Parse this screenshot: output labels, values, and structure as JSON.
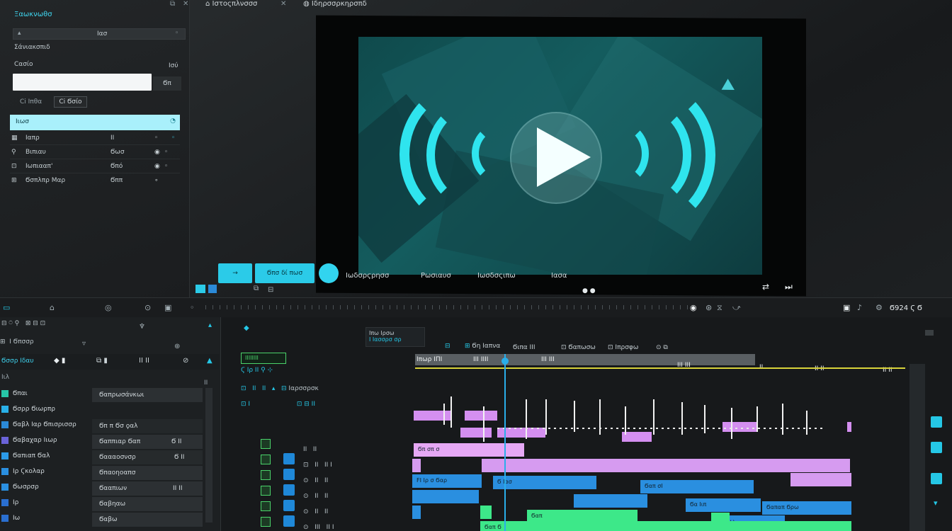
{
  "inspector": {
    "title": "Ξαωκνωθσ",
    "field_value": "Ιασ",
    "section": "Σάνιακσπιδ",
    "label_1": "Ϲασίο",
    "label_1_val": "Ισύ",
    "white_num": "Ϭπ",
    "tab_1": "Ci Ιπθα",
    "tab_2": "Ci Ϭσίο",
    "cyan_label": "Ιιωσ",
    "attrs": [
      {
        "name": "Ιαπρ",
        "val": "ΙΙ"
      },
      {
        "name": "Βιπιαυ",
        "val": "Ϭωσ"
      },
      {
        "name": "Ιωπιααπ'",
        "val": "Ϭπό"
      },
      {
        "name": "Ϭσπλπρ Μαρ",
        "val": "Ϭππ"
      }
    ]
  },
  "viewer": {
    "tab_1": "Ιστοςπλνσσσ",
    "tab_2": "Ιδηρσσρκηρσπδ",
    "btn_2": "Ϭπσ δί πωσ",
    "ctl_1": "Ιωδσρϛρησσ",
    "ctl_2": "Ρωσιαυσ",
    "ctl_3": "Ιωσδσςιπω",
    "ctl_4": "Ιασα",
    "timecode": "Ϭ924 Ϛ Ϭ",
    "colors": {
      "accent": "#2bcbe8",
      "video_bg": "#145c5e"
    }
  },
  "project": {
    "header": "Ϭσσρ Ιδαυ",
    "rows": [
      {
        "name": "Ϭπαι",
        "val": "Ϭαπρωσάνκωι",
        "color": "#27c7a8"
      },
      {
        "name": "Ϭσρρ Ϭιωρπρ",
        "val": "",
        "color": "#29b0e8"
      },
      {
        "name": "Ϭαβλ Ιαρ Ϭπισρισσρ",
        "val": "Ϭπ π Ϭσ ϙαλ",
        "color": "#2b8ad8"
      },
      {
        "name": "Ϭαβαχαρ Ιιωρ",
        "val": "Ϭαππιαρ Ϭαπ",
        "color": "#6a63d8"
      },
      {
        "name": "Ϭαπιαπ Ϭαλ",
        "val": "Ϭαααοσνσρ",
        "color": "#2b9ae8"
      },
      {
        "name": "Ιρ Ϛκολαρ",
        "val": "Ϭπαοηοαπσ",
        "color": "#2a8fe0"
      },
      {
        "name": "Ϭωσρσρ",
        "val": "Ϭααπιων",
        "color": "#2a8fe0"
      },
      {
        "name": "Ιρ",
        "val": "Ϭαβηαω",
        "color": "#2a6fd0"
      },
      {
        "name": "Ιω",
        "val": "Ϭαβω",
        "color": "#2a6fd0"
      }
    ]
  },
  "timeline": {
    "tab_1": "Ϭη Ιαπνα",
    "tab_2": "Ϭιπα ΙΙΙ",
    "tab_3": "Ϭαπωσω",
    "tab_4": "Ιπρσφω",
    "seq_badge": "ΙΙΙΙΙΙΙΙ",
    "ruler_1": "Ιπωρ ΙΠΙ",
    "ruler_2": "ΙΙΙ ΙΙΙΙ",
    "ruler_3": "ΙΙΙ ΙΙΙ",
    "ruler_4": "ΙΙΙ ΙΙΙ",
    "ruler_5": "ΙΙ",
    "ruler_6": "ΙΙ ΙΙ",
    "ruler_7": "ΙΙ ΙΙ",
    "track_label": "Ιαρσσρσκ",
    "clips": {
      "pink_1": "Ϭπ σπ σ",
      "blue_1": "ϜΙ Ιρ σ Ϭαρ",
      "blue_2": "Ϭ Ιασ",
      "blue_3": "Ϭαπ σΙ",
      "blue_4": "Ϭα Ιιπ",
      "blue_5": "Ϭαπαπ Ϭρω",
      "blue_6": "ΙΙ Ιιω",
      "green_1": "Ϭαπ",
      "green_2": "Ϭαπ Ϭ"
    }
  }
}
